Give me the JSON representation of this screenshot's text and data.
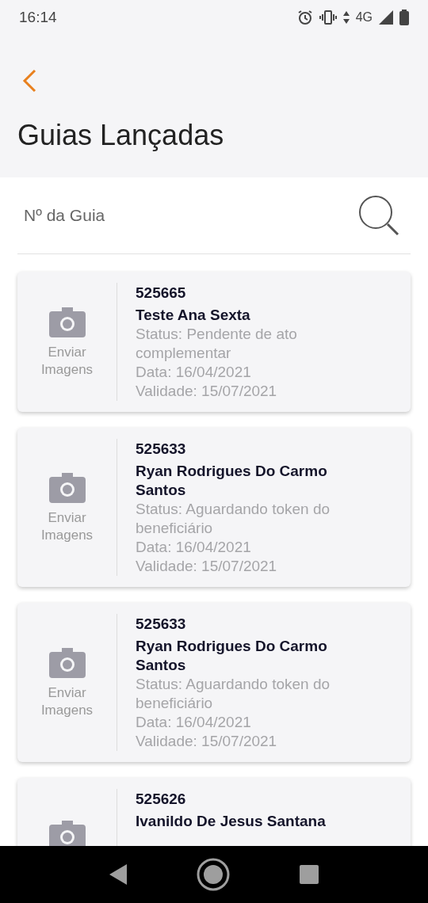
{
  "status_bar": {
    "time": "16:14",
    "network": "4G"
  },
  "header": {
    "title": "Guias Lançadas"
  },
  "search": {
    "placeholder": "Nº da Guia"
  },
  "guides": [
    {
      "number": "525665",
      "name": "Teste Ana Sexta",
      "upload_label": "Enviar Imagens",
      "status": "Status: Pendente de ato complementar",
      "date": "Data: 16/04/2021",
      "validity": "Validade: 15/07/2021"
    },
    {
      "number": "525633",
      "name": "Ryan Rodrigues Do Carmo Santos",
      "upload_label": "Enviar Imagens",
      "status": "Status: Aguardando token do beneficiário",
      "date": "Data: 16/04/2021",
      "validity": "Validade: 15/07/2021"
    },
    {
      "number": "525633",
      "name": "Ryan Rodrigues Do Carmo Santos",
      "upload_label": "Enviar Imagens",
      "status": "Status: Aguardando token do beneficiário",
      "date": "Data: 16/04/2021",
      "validity": "Validade: 15/07/2021"
    },
    {
      "number": "525626",
      "name": "Ivanildo De Jesus Santana"
    }
  ]
}
